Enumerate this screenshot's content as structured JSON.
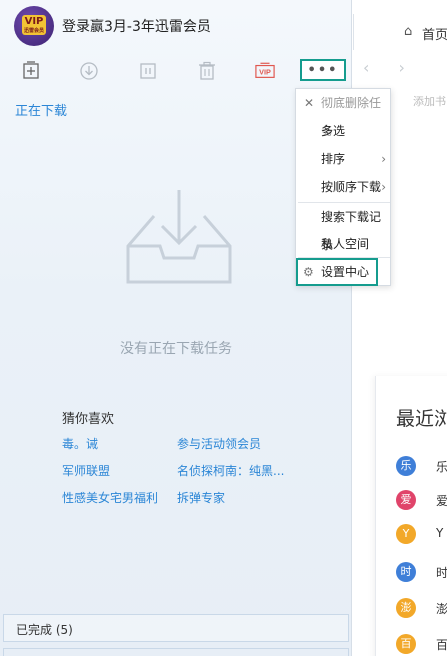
{
  "header": {
    "title": "登录赢3月-3年迅雷会员",
    "avatar_badge": "VIP",
    "avatar_sub": "迅雷会员"
  },
  "toolbar": {
    "new_task_icon": "plus-box-icon",
    "start_icon": "download-circle-icon",
    "pause_icon": "pause-icon",
    "delete_icon": "trash-icon",
    "vip_label": "VIP",
    "more_label": "•••"
  },
  "tabs": {
    "downloading": "正在下载"
  },
  "empty": {
    "message": "没有正在下载任务"
  },
  "recommend": {
    "title": "猜你喜欢",
    "items": [
      "毒。诫",
      "参与活动领会员",
      "军师联盟",
      "名侦探柯南：纯黑...",
      "性感美女宅男福利",
      "拆弹专家"
    ]
  },
  "completed": {
    "label": "已完成 (5)"
  },
  "browser": {
    "home_tab": "首页",
    "home_icon": "home-icon",
    "address_placeholder": "添加书",
    "recent_title": "最近浏",
    "recent_items": [
      {
        "badge": "乐",
        "color": "#3f7fd8",
        "text": "乐"
      },
      {
        "badge": "爱",
        "color": "#e0446a",
        "text": "爱"
      },
      {
        "badge": "Y",
        "color": "#f2a829",
        "text": "Y"
      },
      {
        "badge": "时",
        "color": "#3f7fd8",
        "text": "时"
      },
      {
        "badge": "澎",
        "color": "#f2a829",
        "text": "澎"
      },
      {
        "badge": "百",
        "color": "#f2a829",
        "text": "百"
      }
    ]
  },
  "menu": {
    "delete_all": "彻底删除任务",
    "multi_select": "多选",
    "sort": "排序",
    "download_in_order": "按顺序下载",
    "search_records": "搜索下载记录",
    "private_space": "私人空间",
    "settings": "设置中心"
  },
  "colors": {
    "accent": "#2b86d6",
    "highlight_border": "#159c8e"
  }
}
